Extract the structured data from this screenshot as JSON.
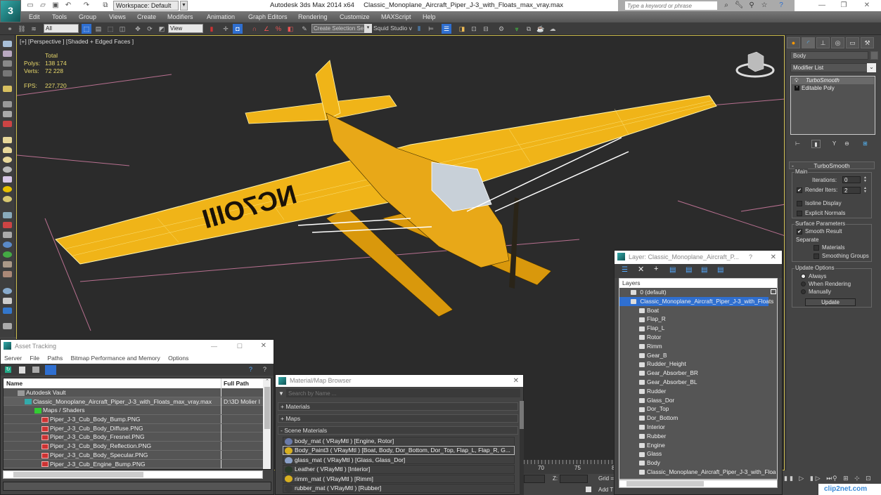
{
  "titlebar": {
    "workspace": "Workspace: Default",
    "app_name": "Autodesk 3ds Max  2014 x64",
    "file_name": "Classic_Monoplane_Aircraft_Piper_J-3_with_Floats_max_vray.max",
    "search_placeholder": "Type a keyword or phrase",
    "minimize": "—",
    "restore": "❐",
    "close": "✕"
  },
  "menu": [
    "Edit",
    "Tools",
    "Group",
    "Views",
    "Create",
    "Modifiers",
    "Animation",
    "Graph Editors",
    "Rendering",
    "Customize",
    "MAXScript",
    "Help"
  ],
  "toolbar": {
    "selection_filter": "All",
    "ref_coord": "View",
    "named_selection": "Create Selection Se",
    "squid_studio": "Squid Studio v"
  },
  "viewport": {
    "label": "[+] [Perspective ] [Shaded + Edged Faces ]",
    "stats_header": "Total",
    "polys_label": "Polys:",
    "polys_value": "138 174",
    "verts_label": "Verts:",
    "verts_value": "72 228",
    "fps_label": "FPS:",
    "fps_value": "227,720",
    "registration": "NC7OIII"
  },
  "command_panel": {
    "object_name": "Body",
    "modifier_list": "Modifier List",
    "stack": [
      "TurboSmooth",
      "Editable Poly"
    ],
    "rollout_title": "TurboSmooth",
    "main_group": "Main",
    "iterations_label": "Iterations:",
    "iterations_value": "0",
    "render_iters_label": "Render Iters:",
    "render_iters_value": "2",
    "render_iters_checked": true,
    "isoline_display": "Isoline Display",
    "explicit_normals": "Explicit Normals",
    "surface_group": "Surface Parameters",
    "smooth_result": "Smooth Result",
    "smooth_result_checked": true,
    "separate_label": "Separate",
    "materials": "Materials",
    "smoothing_groups": "Smoothing Groups",
    "update_group": "Update Options",
    "always": "Always",
    "when_rendering": "When Rendering",
    "manually": "Manually",
    "update_button": "Update",
    "update_selected": "Always"
  },
  "asset_tracking": {
    "title": "Asset Tracking",
    "menu": [
      "Server",
      "File",
      "Paths",
      "Bitmap Performance and Memory",
      "Options"
    ],
    "col_name": "Name",
    "col_path": "Full Path",
    "rows": [
      {
        "name": "Autodesk Vault",
        "path": "",
        "level": 1,
        "icon": "vault"
      },
      {
        "name": "Classic_Monoplane_Aircraft_Piper_J-3_with_Floats_max_vray.max",
        "path": "D:\\3D Molier I",
        "level": 2,
        "icon": "max"
      },
      {
        "name": "Maps / Shaders",
        "path": "",
        "level": 3,
        "icon": "maps"
      },
      {
        "name": "Piper_J-3_Cub_Body_Bump.PNG",
        "path": "",
        "level": 4,
        "icon": "png"
      },
      {
        "name": "Piper_J-3_Cub_Body_Diffuse.PNG",
        "path": "",
        "level": 4,
        "icon": "png"
      },
      {
        "name": "Piper_J-3_Cub_Body_Fresnel.PNG",
        "path": "",
        "level": 4,
        "icon": "png"
      },
      {
        "name": "Piper_J-3_Cub_Body_Reflection.PNG",
        "path": "",
        "level": 4,
        "icon": "png"
      },
      {
        "name": "Piper_J-3_Cub_Body_Specular.PNG",
        "path": "",
        "level": 4,
        "icon": "png"
      },
      {
        "name": "Piper_J-3_Cub_Engine_Bump.PNG",
        "path": "",
        "level": 4,
        "icon": "png"
      }
    ]
  },
  "material_browser": {
    "title": "Material/Map Browser",
    "search_placeholder": "Search by Name ...",
    "sections": [
      "+ Materials",
      "+ Maps",
      "- Scene Materials"
    ],
    "materials": [
      {
        "text": "body_mat  ( VRayMtl ) [Engine, Rotor]",
        "color": "#6a7aa8",
        "selected": false
      },
      {
        "text": "Body_Paint3  ( VRayMtl ) [Boat, Body, Dor_Bottom, Dor_Top, Flap_L, Flap_R, G...",
        "color": "#d8b020",
        "selected": true
      },
      {
        "text": "glass_mat  ( VRayMtl ) [Glass, Glass_Dor]",
        "color": "#8aa0c8",
        "selected": false
      },
      {
        "text": "Leather  ( VRayMtl ) [Interior]",
        "color": "#2a3a2a",
        "selected": false
      },
      {
        "text": "rimm_mat  ( VRayMtl ) [Rimm]",
        "color": "#d8b020",
        "selected": false
      },
      {
        "text": "rubber_mat  ( VRayMtl ) [Rubber]",
        "color": "#3a3a3a",
        "selected": false
      }
    ]
  },
  "layer_explorer": {
    "title": "Layer: Classic_Monoplane_Aircraft_P...",
    "help": "?",
    "header": "Layers",
    "default_layer": "0 (default)",
    "active_layer": "Classic_Monoplane_Aircraft_Piper_J-3_with_Floats",
    "objects": [
      "Boat",
      "Flap_R",
      "Flap_L",
      "Rotor",
      "Rimm",
      "Gear_B",
      "Rudder_Height",
      "Gear_Absorber_BR",
      "Gear_Absorber_BL",
      "Rudder",
      "Glass_Dor",
      "Dor_Top",
      "Dor_Bottom",
      "Interior",
      "Rubber",
      "Engine",
      "Glass",
      "Body",
      "Classic_Monoplane_Aircraft_Piper_J-3_with_Floa"
    ]
  },
  "timeline": {
    "ticks": [
      "70",
      "75",
      "8"
    ],
    "z_label": "Z:",
    "grid_label": "Grid =",
    "add_time_tag": "Add T"
  },
  "watermark": "clip2net.com",
  "colors": {
    "accent_blue": "#2f6fd0",
    "viewport_border": "#c8b84a",
    "plane_yellow": "#e8a818"
  }
}
